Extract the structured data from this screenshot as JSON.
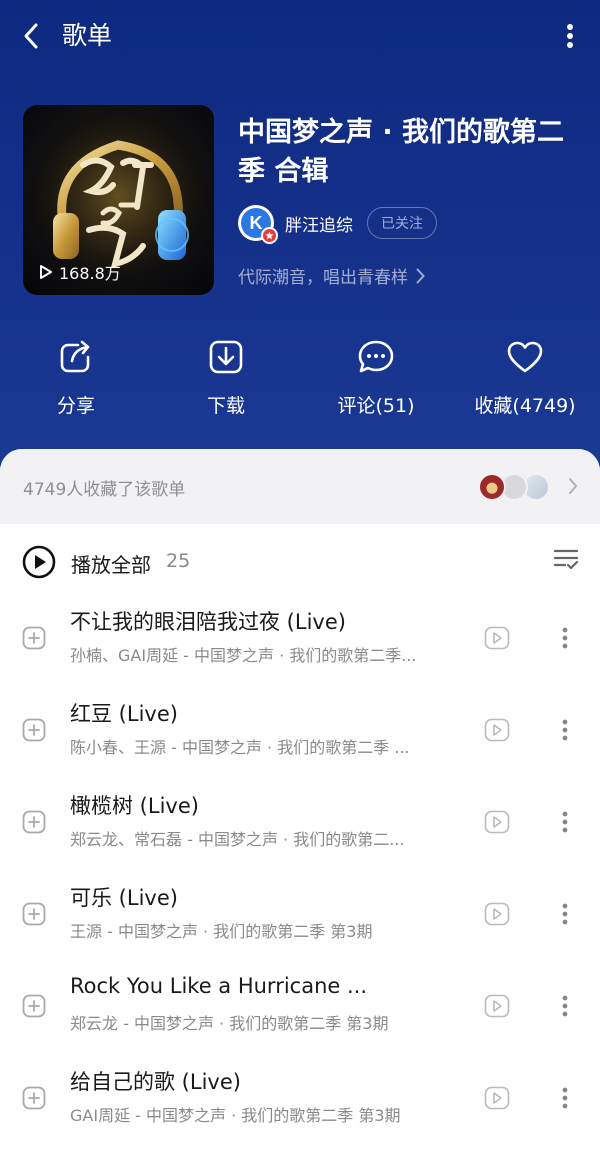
{
  "header": {
    "title": "歌单"
  },
  "playlist": {
    "title": "中国梦之声 · 我们的歌第二季 合辑",
    "play_count": "168.8万",
    "cover_icon": "我们的歌-cover",
    "creator": {
      "avatar_letter": "K",
      "name": "胖汪追综",
      "follow_status": "已关注"
    },
    "description": "代际潮音，唱出青春样"
  },
  "actions": [
    {
      "icon": "share-icon",
      "label": "分享"
    },
    {
      "icon": "download-icon",
      "label": "下载"
    },
    {
      "icon": "comment-icon",
      "label": "评论(51)"
    },
    {
      "icon": "heart-icon",
      "label": "收藏(4749)"
    }
  ],
  "collectors": {
    "text": "4749人收藏了该歌单"
  },
  "play_all": {
    "label": "播放全部",
    "count": "25"
  },
  "songs": [
    {
      "title": "不让我的眼泪陪我过夜 (Live)",
      "subtitle": "孙楠、GAI周延 - 中国梦之声 · 我们的歌第二季..."
    },
    {
      "title": "红豆 (Live)",
      "subtitle": "陈小春、王源 - 中国梦之声 · 我们的歌第二季 ..."
    },
    {
      "title": "橄榄树 (Live)",
      "subtitle": "郑云龙、常石磊 - 中国梦之声 · 我们的歌第二..."
    },
    {
      "title": "可乐 (Live)",
      "subtitle": "王源 - 中国梦之声 · 我们的歌第二季 第3期"
    },
    {
      "title": "Rock You Like a Hurricane ...",
      "subtitle": "郑云龙 - 中国梦之声 · 我们的歌第二季 第3期"
    },
    {
      "title": "给自己的歌 (Live)",
      "subtitle": "GAI周延 - 中国梦之声 · 我们的歌第二季 第3期"
    }
  ],
  "colors": {
    "hero_bg": "#142f88",
    "sheet_bg": "#ffffff",
    "collect_bg": "#f2f2f5",
    "accent_blue": "#2b78e4",
    "badge_red": "#e83a3a"
  }
}
